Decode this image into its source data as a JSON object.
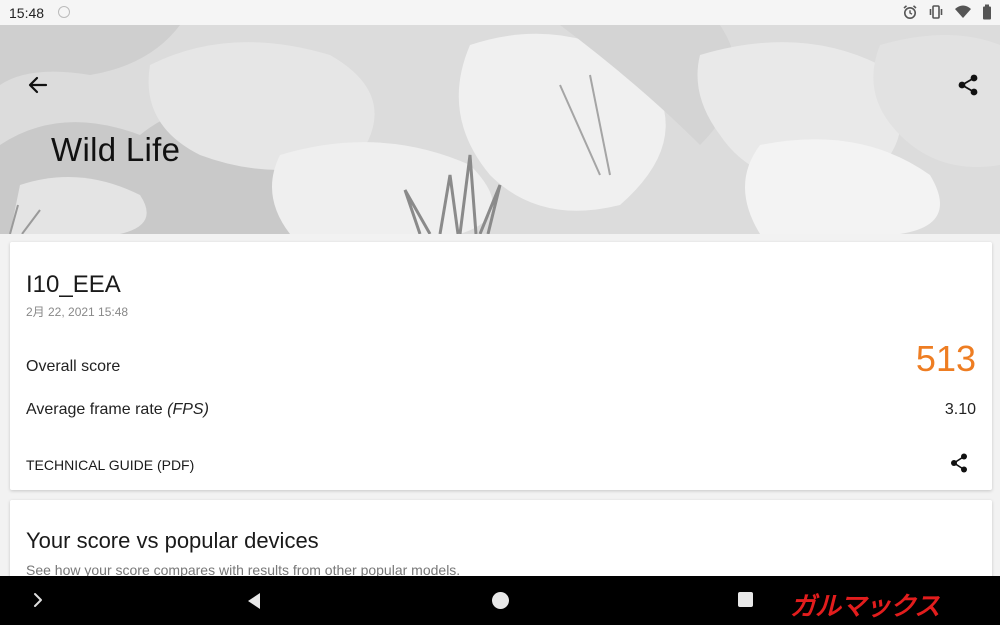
{
  "status_bar": {
    "time": "15:48",
    "icons": [
      "notification-icon",
      "alarm-icon",
      "vibrate-icon",
      "wifi-icon",
      "battery-icon"
    ]
  },
  "header": {
    "title": "Wild Life",
    "back_icon": "arrow-back-icon",
    "share_icon": "share-icon"
  },
  "result": {
    "device": "I10_EEA",
    "date": "2月 22, 2021 15:48",
    "overall_label": "Overall score",
    "overall_score": "513",
    "fps_label": "Average frame rate",
    "fps_unit": "(FPS)",
    "fps_value": "3.10",
    "guide_label": "TECHNICAL GUIDE (PDF)",
    "accent_color": "#ee7d22"
  },
  "comparison": {
    "title": "Your score vs popular devices",
    "subtitle": "See how your score compares with results from other popular models."
  },
  "nav_bar": {
    "buttons": [
      "expand-icon",
      "back-triangle-icon",
      "home-circle-icon",
      "recent-square-icon"
    ]
  },
  "watermark": {
    "text": "ガルマックス"
  }
}
